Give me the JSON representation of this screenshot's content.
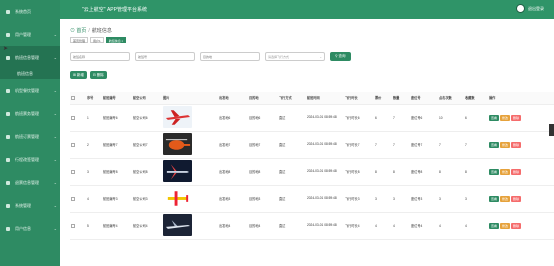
{
  "sidebar": {
    "items": [
      {
        "label": "系统首页",
        "arrow": ""
      },
      {
        "label": "用户管理",
        "arrow": "⌄"
      },
      {
        "label": "航班信息管理",
        "arrow": "⌄"
      },
      {
        "label": "机型餐饮管理",
        "arrow": "⌄"
      },
      {
        "label": "航班票务管理",
        "arrow": "⌄"
      },
      {
        "label": "航班订票管理",
        "arrow": "⌄"
      },
      {
        "label": "行程改签管理",
        "arrow": "⌄"
      },
      {
        "label": "退票信息管理",
        "arrow": "⌄"
      },
      {
        "label": "系统管理",
        "arrow": "⌄"
      },
      {
        "label": "用户信息",
        "arrow": "⌄"
      }
    ],
    "sub_item": "航班信息"
  },
  "header": {
    "title": "\"云上航空\" APP管理平台系统",
    "logout": "退出登录"
  },
  "breadcrumb": {
    "home": "首页",
    "current": "航班信息"
  },
  "tags": [
    "首页管理",
    "用户1",
    "航班信息 ×"
  ],
  "search": {
    "field1_placeholder": "航班名称",
    "field2_placeholder": "航班号",
    "field3_placeholder": "目的地",
    "select_placeholder": "请选择飞行方式",
    "search_label": "查询"
  },
  "actions": {
    "add_label": "新增",
    "delete_label": "删除"
  },
  "table": {
    "headers": [
      "",
      "序号",
      "航班编号",
      "航空公司",
      "图片",
      "出发地",
      "目的地",
      "飞行方式",
      "航班时间",
      "飞行时长",
      "票价",
      "数量",
      "座位号",
      "点击次数",
      "收藏数",
      "操作"
    ],
    "rows": [
      {
        "index": "1",
        "flight_no": "航班编号6",
        "airline": "航空公司6",
        "departure": "出发地6",
        "destination": "目的地6",
        "mode": "直达",
        "time": "2024-03-01 08:59:48",
        "duration": "飞行时长6",
        "price": "6",
        "qty": "7",
        "seat": "座位号6",
        "clicks": "10",
        "favs": "6",
        "img": "jet"
      },
      {
        "index": "2",
        "flight_no": "航班编号7",
        "airline": "航空公司7",
        "departure": "出发地7",
        "destination": "目的地7",
        "mode": "直达",
        "time": "2024-03-01 08:59:48",
        "duration": "飞行时长7",
        "price": "7",
        "qty": "7",
        "seat": "座位号7",
        "clicks": "7",
        "favs": "7",
        "img": "heli"
      },
      {
        "index": "3",
        "flight_no": "航班编号8",
        "airline": "航空公司8",
        "departure": "出发地8",
        "destination": "目的地8",
        "mode": "直达",
        "time": "2024-03-01 08:59:48",
        "duration": "飞行时长8",
        "price": "8",
        "qty": "8",
        "seat": "座位号8",
        "clicks": "8",
        "favs": "8",
        "img": "fighter"
      },
      {
        "index": "4",
        "flight_no": "航班编号3",
        "airline": "航空公司3",
        "departure": "出发地3",
        "destination": "目的地3",
        "mode": "直达",
        "time": "2024-03-01 08:59:48",
        "duration": "飞行时长3",
        "price": "3",
        "qty": "3",
        "seat": "座位号3",
        "clicks": "3",
        "favs": "3",
        "img": "stunt"
      },
      {
        "index": "5",
        "flight_no": "航班编号4",
        "airline": "航空公司4",
        "departure": "出发地4",
        "destination": "目的地4",
        "mode": "直达",
        "time": "2024-03-01 08:59:48",
        "duration": "飞行时长4",
        "price": "4",
        "qty": "4",
        "seat": "座位号4",
        "clicks": "4",
        "favs": "4",
        "img": "jet2"
      }
    ],
    "ops": {
      "view": "查看",
      "edit": "修改",
      "del": "删除"
    }
  },
  "colors": {
    "brand": "#2e8b63",
    "edit": "#e6a23c",
    "delete": "#f56c6c"
  }
}
